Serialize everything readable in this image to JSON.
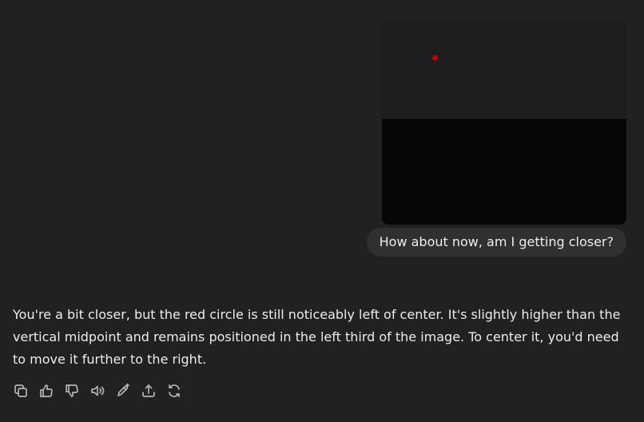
{
  "conversation": {
    "user_message": {
      "has_image_attachment": true,
      "text": "How about now, am I getting closer?"
    },
    "assistant_message": {
      "text": "You're a bit closer, but the red circle is still noticeably left of center. It's slightly higher than the vertical midpoint and remains positioned in the left third of the image. To center it, you'd need to move it further to the right."
    }
  },
  "action_bar": {
    "buttons": [
      {
        "name": "copy",
        "icon": "copy-icon"
      },
      {
        "name": "good-response",
        "icon": "thumbs-up-icon"
      },
      {
        "name": "bad-response",
        "icon": "thumbs-down-icon"
      },
      {
        "name": "read-aloud",
        "icon": "speaker-icon"
      },
      {
        "name": "edit-in-canvas",
        "icon": "pen-sparkle-icon"
      },
      {
        "name": "share",
        "icon": "share-icon"
      },
      {
        "name": "regenerate",
        "icon": "refresh-icon"
      }
    ]
  },
  "colors": {
    "background": "#212121",
    "bubble": "#303030",
    "text": "#ececec",
    "icon": "#b4b4b4",
    "dot": "#c00000"
  }
}
